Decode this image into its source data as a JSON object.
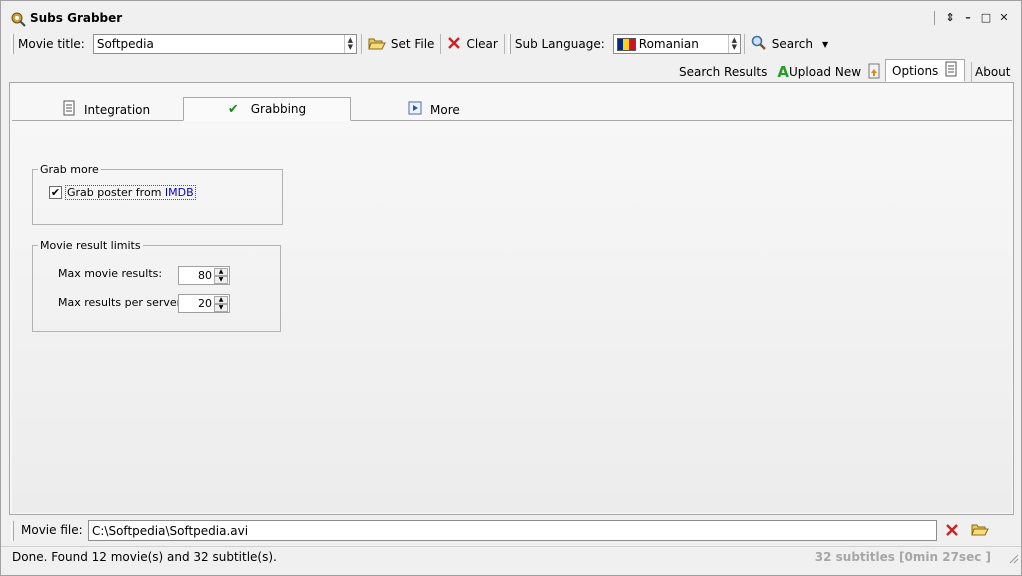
{
  "window": {
    "title": "Subs Grabber",
    "controls": {
      "restore": "⇕",
      "minimize": "–",
      "maximize": "□",
      "close": "✕"
    }
  },
  "toolbar": {
    "movie_title_label": "Movie title:",
    "movie_title_value": "Softpedia",
    "set_file_label": "Set File",
    "clear_label": "Clear",
    "sub_language_label": "Sub Language:",
    "sub_language_value": "Romanian",
    "search_label": "Search"
  },
  "top_tabs": {
    "search_results": "Search Results",
    "upload_new": "Upload New",
    "options": "Options",
    "about": "About"
  },
  "sub_tabs": {
    "integration": "Integration",
    "grabbing": "Grabbing",
    "more": "More"
  },
  "grab_more": {
    "legend": "Grab more",
    "checkbox_text": "Grab poster from ",
    "checkbox_link": "IMDB",
    "checked": true
  },
  "movie_limits": {
    "legend": "Movie result limits",
    "max_movie_results_label": "Max movie results:",
    "max_movie_results_value": "80",
    "max_per_server_label": "Max results per server:",
    "max_per_server_value": "20"
  },
  "file_bar": {
    "label": "Movie file:",
    "value": "C:\\Softpedia\\Softpedia.avi"
  },
  "status": {
    "left": "Done. Found 12 movie(s) and 32 subtitle(s).",
    "right": "32 subtitles  [0min 27sec ]"
  },
  "colors": {
    "accent_link": "#0000cc",
    "clear_red": "#cc2222",
    "check_green": "#1a8a1a"
  }
}
